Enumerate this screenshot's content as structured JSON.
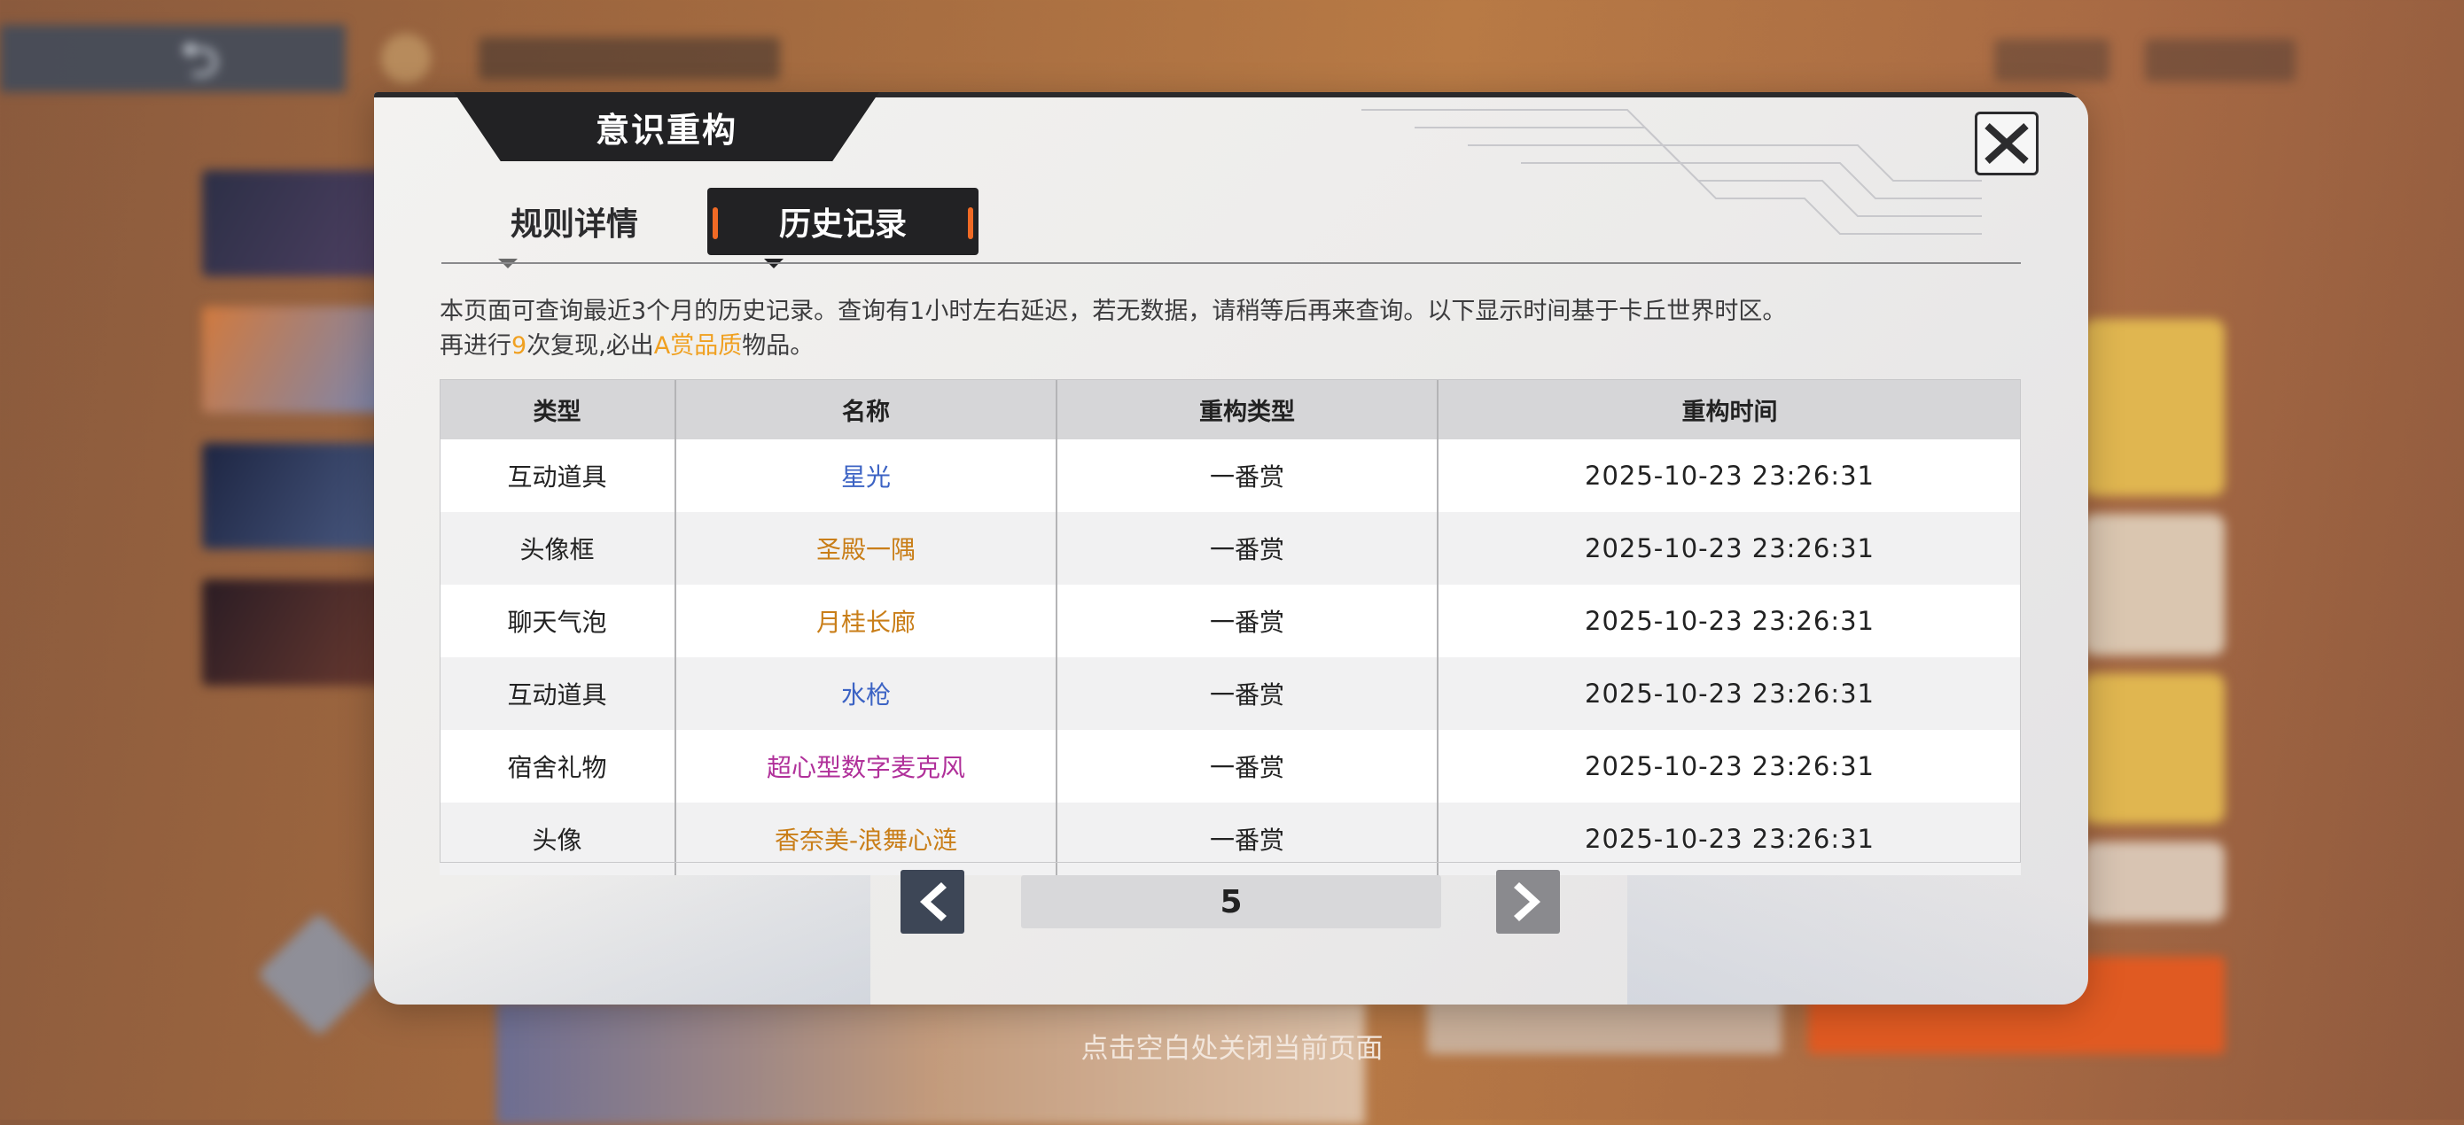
{
  "modal": {
    "title": "意识重构",
    "tabs": [
      "规则详情",
      "历史记录"
    ],
    "active_tab": "历史记录",
    "desc_line1": "本页面可查询最近3个月的历史记录。查询有1小时左右延迟，若无数据，请稍等后再来查询。以下显示时间基于卡丘世界时区。",
    "desc_line2": {
      "prefix": "再进行",
      "count": "9",
      "mid": "次复现,必出",
      "quality": "A赏品质",
      "suffix": "物品。"
    },
    "table": {
      "headers": [
        "类型",
        "名称",
        "重构类型",
        "重构时间"
      ],
      "rows": [
        {
          "type": "互动道具",
          "name": "星光",
          "name_color": "blue",
          "recon_type": "一番赏",
          "time": "2025-10-23   23:26:31"
        },
        {
          "type": "头像框",
          "name": "圣殿一隅",
          "name_color": "orange",
          "recon_type": "一番赏",
          "time": "2025-10-23   23:26:31"
        },
        {
          "type": "聊天气泡",
          "name": "月桂长廊",
          "name_color": "orange",
          "recon_type": "一番赏",
          "time": "2025-10-23   23:26:31"
        },
        {
          "type": "互动道具",
          "name": "水枪",
          "name_color": "blue",
          "recon_type": "一番赏",
          "time": "2025-10-23   23:26:31"
        },
        {
          "type": "宿舍礼物",
          "name": "超心型数字麦克风",
          "name_color": "purple",
          "recon_type": "一番赏",
          "time": "2025-10-23   23:26:31"
        },
        {
          "type": "头像",
          "name": "香奈美-浪舞心涟",
          "name_color": "orange",
          "recon_type": "一番赏",
          "time": "2025-10-23   23:26:31"
        }
      ]
    },
    "pagination": {
      "current_page": "5",
      "prev_icon": "chevron-left-icon",
      "next_icon": "chevron-right-icon"
    },
    "close_icon": "close-icon"
  },
  "footer_hint": "点击空白处关闭当前页面",
  "colors": {
    "accent_orange": "#f06a25",
    "highlight_gold": "#f0a020",
    "name_blue": "#3c63c4",
    "name_orange": "#c97e18",
    "name_purple": "#b0309a",
    "dark": "#222224"
  }
}
